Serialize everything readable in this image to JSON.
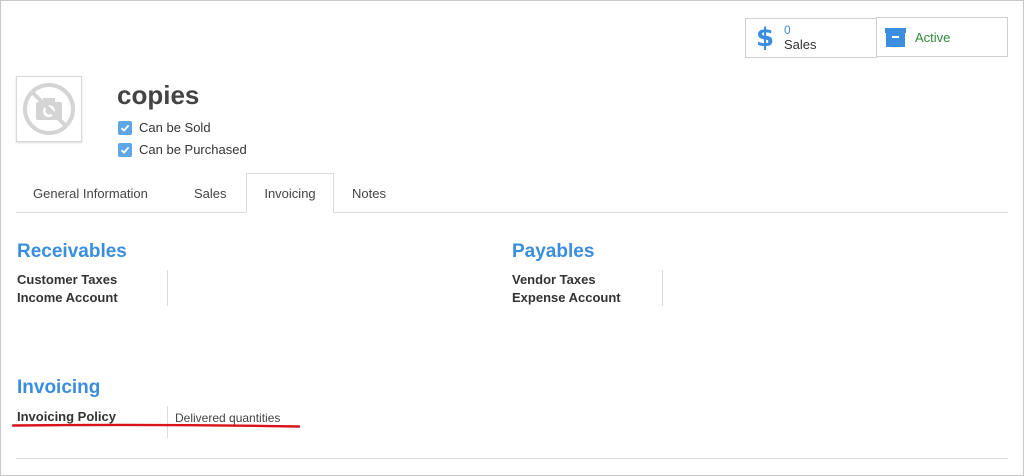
{
  "smart_buttons": {
    "sales": {
      "value": "0",
      "label": "Sales",
      "icon": "dollar-icon"
    },
    "active": {
      "label": "Active",
      "icon": "archive-icon"
    }
  },
  "product": {
    "name": "copies",
    "checkboxes": [
      {
        "label": "Can be Sold",
        "checked": true
      },
      {
        "label": "Can be Purchased",
        "checked": true
      }
    ]
  },
  "tabs": [
    {
      "label": "General Information",
      "active": false
    },
    {
      "label": "Sales",
      "active": false
    },
    {
      "label": "Invoicing",
      "active": true
    },
    {
      "label": "Notes",
      "active": false
    }
  ],
  "receivables": {
    "title": "Receivables",
    "fields": [
      "Customer Taxes",
      "Income Account"
    ]
  },
  "payables": {
    "title": "Payables",
    "fields": [
      "Vendor Taxes",
      "Expense Account"
    ]
  },
  "invoicing": {
    "title": "Invoicing",
    "policy_label": "Invoicing Policy",
    "policy_value": "Delivered quantities"
  },
  "colors": {
    "accent": "#3b8de0",
    "active_green": "#2f8a3a",
    "annotation_red": "#d9121b"
  }
}
